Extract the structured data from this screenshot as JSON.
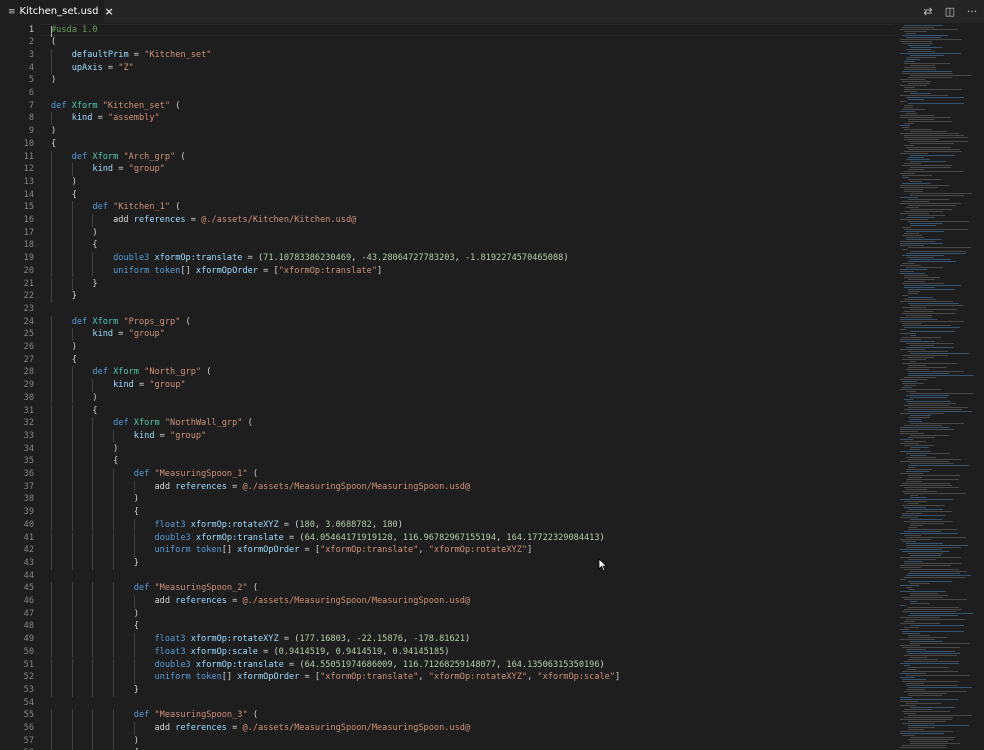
{
  "tab": {
    "icon": "≡",
    "title": "Kitchen_set.usd",
    "close": "×"
  },
  "actions": [
    {
      "name": "open-changes-icon",
      "glyph": "⇄"
    },
    {
      "name": "split-editor-icon",
      "glyph": "◫"
    },
    {
      "name": "more-actions-icon",
      "glyph": "···"
    }
  ],
  "active_line": 1,
  "lines": [
    [
      [
        "com",
        "#usda 1.0"
      ]
    ],
    [
      [
        "plain",
        "("
      ]
    ],
    [
      [
        "plain",
        "    "
      ],
      [
        "id",
        "defaultPrim"
      ],
      [
        "plain",
        " = "
      ],
      [
        "str",
        "\"Kitchen_set\""
      ]
    ],
    [
      [
        "plain",
        "    "
      ],
      [
        "id",
        "upAxis"
      ],
      [
        "plain",
        " = "
      ],
      [
        "str",
        "\"Z\""
      ]
    ],
    [
      [
        "plain",
        ")"
      ]
    ],
    [],
    [
      [
        "kw",
        "def "
      ],
      [
        "ty",
        "Xform "
      ],
      [
        "str",
        "\"Kitchen_set\""
      ],
      [
        "plain",
        " ("
      ]
    ],
    [
      [
        "plain",
        "    "
      ],
      [
        "id",
        "kind"
      ],
      [
        "plain",
        " = "
      ],
      [
        "str",
        "\"assembly\""
      ]
    ],
    [
      [
        "plain",
        ")"
      ]
    ],
    [
      [
        "plain",
        "{"
      ]
    ],
    [
      [
        "plain",
        "    "
      ],
      [
        "kw",
        "def "
      ],
      [
        "ty",
        "Xform "
      ],
      [
        "str",
        "\"Arch_grp\""
      ],
      [
        "plain",
        " ("
      ]
    ],
    [
      [
        "plain",
        "        "
      ],
      [
        "id",
        "kind"
      ],
      [
        "plain",
        " = "
      ],
      [
        "str",
        "\"group\""
      ]
    ],
    [
      [
        "plain",
        "    )"
      ]
    ],
    [
      [
        "plain",
        "    {"
      ]
    ],
    [
      [
        "plain",
        "        "
      ],
      [
        "kw",
        "def "
      ],
      [
        "str",
        "\"Kitchen_1\""
      ],
      [
        "plain",
        " ("
      ]
    ],
    [
      [
        "plain",
        "            add "
      ],
      [
        "id",
        "references"
      ],
      [
        "plain",
        " = "
      ],
      [
        "path",
        "@./assets/Kitchen/Kitchen.usd@"
      ]
    ],
    [
      [
        "plain",
        "        )"
      ]
    ],
    [
      [
        "plain",
        "        {"
      ]
    ],
    [
      [
        "plain",
        "            "
      ],
      [
        "kw",
        "double3 "
      ],
      [
        "id",
        "xformOp:translate"
      ],
      [
        "plain",
        " = ("
      ],
      [
        "num",
        "71.10783386230469"
      ],
      [
        "plain",
        ", "
      ],
      [
        "num",
        "-43.28064727783203"
      ],
      [
        "plain",
        ", "
      ],
      [
        "num",
        "-1.8192274570465088"
      ],
      [
        "plain",
        ")"
      ]
    ],
    [
      [
        "plain",
        "            "
      ],
      [
        "kw",
        "uniform token"
      ],
      [
        "plain",
        "[] "
      ],
      [
        "id",
        "xformOpOrder"
      ],
      [
        "plain",
        " = ["
      ],
      [
        "str",
        "\"xformOp:translate\""
      ],
      [
        "plain",
        "]"
      ]
    ],
    [
      [
        "plain",
        "        }"
      ]
    ],
    [
      [
        "plain",
        "    }"
      ]
    ],
    [],
    [
      [
        "plain",
        "    "
      ],
      [
        "kw",
        "def "
      ],
      [
        "ty",
        "Xform "
      ],
      [
        "str",
        "\"Props_grp\""
      ],
      [
        "plain",
        " ("
      ]
    ],
    [
      [
        "plain",
        "        "
      ],
      [
        "id",
        "kind"
      ],
      [
        "plain",
        " = "
      ],
      [
        "str",
        "\"group\""
      ]
    ],
    [
      [
        "plain",
        "    )"
      ]
    ],
    [
      [
        "plain",
        "    {"
      ]
    ],
    [
      [
        "plain",
        "        "
      ],
      [
        "kw",
        "def "
      ],
      [
        "ty",
        "Xform "
      ],
      [
        "str",
        "\"North_grp\""
      ],
      [
        "plain",
        " ("
      ]
    ],
    [
      [
        "plain",
        "            "
      ],
      [
        "id",
        "kind"
      ],
      [
        "plain",
        " = "
      ],
      [
        "str",
        "\"group\""
      ]
    ],
    [
      [
        "plain",
        "        )"
      ]
    ],
    [
      [
        "plain",
        "        {"
      ]
    ],
    [
      [
        "plain",
        "            "
      ],
      [
        "kw",
        "def "
      ],
      [
        "ty",
        "Xform "
      ],
      [
        "str",
        "\"NorthWall_grp\""
      ],
      [
        "plain",
        " ("
      ]
    ],
    [
      [
        "plain",
        "                "
      ],
      [
        "id",
        "kind"
      ],
      [
        "plain",
        " = "
      ],
      [
        "str",
        "\"group\""
      ]
    ],
    [
      [
        "plain",
        "            )"
      ]
    ],
    [
      [
        "plain",
        "            {"
      ]
    ],
    [
      [
        "plain",
        "                "
      ],
      [
        "kw",
        "def "
      ],
      [
        "str",
        "\"MeasuringSpoon_1\""
      ],
      [
        "plain",
        " ("
      ]
    ],
    [
      [
        "plain",
        "                    add "
      ],
      [
        "id",
        "references"
      ],
      [
        "plain",
        " = "
      ],
      [
        "path",
        "@./assets/MeasuringSpoon/MeasuringSpoon.usd@"
      ]
    ],
    [
      [
        "plain",
        "                )"
      ]
    ],
    [
      [
        "plain",
        "                {"
      ]
    ],
    [
      [
        "plain",
        "                    "
      ],
      [
        "kw",
        "float3 "
      ],
      [
        "id",
        "xformOp:rotateXYZ"
      ],
      [
        "plain",
        " = ("
      ],
      [
        "num",
        "180"
      ],
      [
        "plain",
        ", "
      ],
      [
        "num",
        "3.0688782"
      ],
      [
        "plain",
        ", "
      ],
      [
        "num",
        "180"
      ],
      [
        "plain",
        ")"
      ]
    ],
    [
      [
        "plain",
        "                    "
      ],
      [
        "kw",
        "double3 "
      ],
      [
        "id",
        "xformOp:translate"
      ],
      [
        "plain",
        " = ("
      ],
      [
        "num",
        "64.05464171919128"
      ],
      [
        "plain",
        ", "
      ],
      [
        "num",
        "116.96782967155194"
      ],
      [
        "plain",
        ", "
      ],
      [
        "num",
        "164.17722329084413"
      ],
      [
        "plain",
        ")"
      ]
    ],
    [
      [
        "plain",
        "                    "
      ],
      [
        "kw",
        "uniform token"
      ],
      [
        "plain",
        "[] "
      ],
      [
        "id",
        "xformOpOrder"
      ],
      [
        "plain",
        " = ["
      ],
      [
        "str",
        "\"xformOp:translate\""
      ],
      [
        "plain",
        ", "
      ],
      [
        "str",
        "\"xformOp:rotateXYZ\""
      ],
      [
        "plain",
        "]"
      ]
    ],
    [
      [
        "plain",
        "                }"
      ]
    ],
    [],
    [
      [
        "plain",
        "                "
      ],
      [
        "kw",
        "def "
      ],
      [
        "str",
        "\"MeasuringSpoon_2\""
      ],
      [
        "plain",
        " ("
      ]
    ],
    [
      [
        "plain",
        "                    add "
      ],
      [
        "id",
        "references"
      ],
      [
        "plain",
        " = "
      ],
      [
        "path",
        "@./assets/MeasuringSpoon/MeasuringSpoon.usd@"
      ]
    ],
    [
      [
        "plain",
        "                )"
      ]
    ],
    [
      [
        "plain",
        "                {"
      ]
    ],
    [
      [
        "plain",
        "                    "
      ],
      [
        "kw",
        "float3 "
      ],
      [
        "id",
        "xformOp:rotateXYZ"
      ],
      [
        "plain",
        " = ("
      ],
      [
        "num",
        "177.16803"
      ],
      [
        "plain",
        ", "
      ],
      [
        "num",
        "-22.15876"
      ],
      [
        "plain",
        ", "
      ],
      [
        "num",
        "-178.81621"
      ],
      [
        "plain",
        ")"
      ]
    ],
    [
      [
        "plain",
        "                    "
      ],
      [
        "kw",
        "float3 "
      ],
      [
        "id",
        "xformOp:scale"
      ],
      [
        "plain",
        " = ("
      ],
      [
        "num",
        "0.9414519"
      ],
      [
        "plain",
        ", "
      ],
      [
        "num",
        "0.9414519"
      ],
      [
        "plain",
        ", "
      ],
      [
        "num",
        "0.94145185"
      ],
      [
        "plain",
        ")"
      ]
    ],
    [
      [
        "plain",
        "                    "
      ],
      [
        "kw",
        "double3 "
      ],
      [
        "id",
        "xformOp:translate"
      ],
      [
        "plain",
        " = ("
      ],
      [
        "num",
        "64.55051974686009"
      ],
      [
        "plain",
        ", "
      ],
      [
        "num",
        "116.71268259148077"
      ],
      [
        "plain",
        ", "
      ],
      [
        "num",
        "164.13506315350196"
      ],
      [
        "plain",
        ")"
      ]
    ],
    [
      [
        "plain",
        "                    "
      ],
      [
        "kw",
        "uniform token"
      ],
      [
        "plain",
        "[] "
      ],
      [
        "id",
        "xformOpOrder"
      ],
      [
        "plain",
        " = ["
      ],
      [
        "str",
        "\"xformOp:translate\""
      ],
      [
        "plain",
        ", "
      ],
      [
        "str",
        "\"xformOp:rotateXYZ\""
      ],
      [
        "plain",
        ", "
      ],
      [
        "str",
        "\"xformOp:scale\""
      ],
      [
        "plain",
        "]"
      ]
    ],
    [
      [
        "plain",
        "                }"
      ]
    ],
    [],
    [
      [
        "plain",
        "                "
      ],
      [
        "kw",
        "def "
      ],
      [
        "str",
        "\"MeasuringSpoon_3\""
      ],
      [
        "plain",
        " ("
      ]
    ],
    [
      [
        "plain",
        "                    add "
      ],
      [
        "id",
        "references"
      ],
      [
        "plain",
        " = "
      ],
      [
        "path",
        "@./assets/MeasuringSpoon/MeasuringSpoon.usd@"
      ]
    ],
    [
      [
        "plain",
        "                )"
      ]
    ],
    [
      [
        "plain",
        "                {"
      ]
    ]
  ],
  "colors": {
    "background": "#1e1e1e",
    "keyword": "#569cd6",
    "string": "#ce9178",
    "identifier": "#9cdcfe",
    "number": "#b5cea8"
  }
}
